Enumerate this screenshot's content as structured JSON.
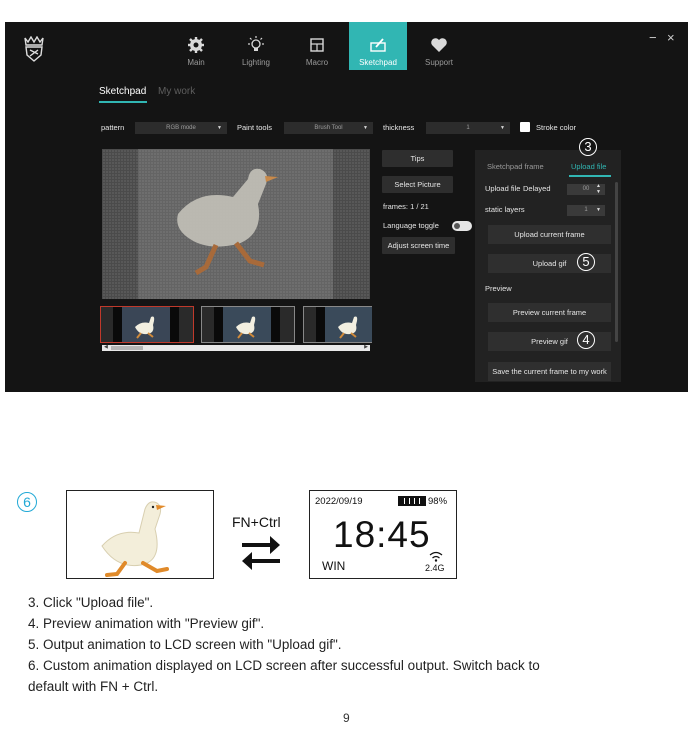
{
  "app": {
    "nav": [
      {
        "label": "Main",
        "icon": "gear-icon"
      },
      {
        "label": "Lighting",
        "icon": "bulb-icon"
      },
      {
        "label": "Macro",
        "icon": "macro-icon"
      },
      {
        "label": "Sketchpad",
        "icon": "sketchpad-icon"
      },
      {
        "label": "Support",
        "icon": "heart-icon"
      }
    ],
    "window_controls": {
      "minimize": "−",
      "close": "×"
    },
    "tabs": {
      "active": "Sketchpad",
      "inactive": "My work"
    },
    "toolbar": {
      "pattern_label": "pattern",
      "pattern_value": "RGB mode",
      "paint_tools_label": "Paint tools",
      "paint_tools_value": "Brush Tool",
      "thickness_label": "thickness",
      "thickness_value": "1",
      "stroke_color_label": "Stroke color"
    },
    "side": {
      "tips": "Tips",
      "select_picture": "Select Picture",
      "frames": "frames: 1 / 21",
      "language_toggle": "Language toggle",
      "adjust_screen_time": "Adjust screen time"
    },
    "panel": {
      "tab_sketchpad_frame": "Sketchpad frame",
      "tab_upload_file": "Upload file",
      "upload_file_label": "Upload file",
      "delayed_label": "Delayed",
      "delayed_value": "00",
      "static_layers_label": "static layers",
      "static_layers_value": "1",
      "upload_current_frame": "Upload current frame",
      "upload_gif": "Upload gif",
      "preview_label": "Preview",
      "preview_current_frame": "Preview current frame",
      "preview_gif": "Preview gif",
      "save_current_frame": "Save the current frame to my work"
    },
    "callouts": {
      "c3": "3",
      "c4": "4",
      "c5": "5"
    }
  },
  "figure": {
    "callout6": "6",
    "shortcut": "FN+Ctrl",
    "lcd": {
      "date": "2022/09/19",
      "battery": "98%",
      "battery_level": 0.98,
      "time": "18:45",
      "mode": "WIN",
      "wireless": "2.4G"
    }
  },
  "instructions": [
    "3. Click \"Upload file\".",
    "4. Preview animation with \"Preview gif\".",
    "5. Output animation to LCD screen with \"Upload gif\".",
    "6. Custom animation displayed on LCD screen after successful output. Switch back to",
    "default with FN + Ctrl."
  ],
  "page_number": "9",
  "colors": {
    "accent": "#31b6b3",
    "callout": "#22a9d6",
    "app_bg": "#141414"
  }
}
